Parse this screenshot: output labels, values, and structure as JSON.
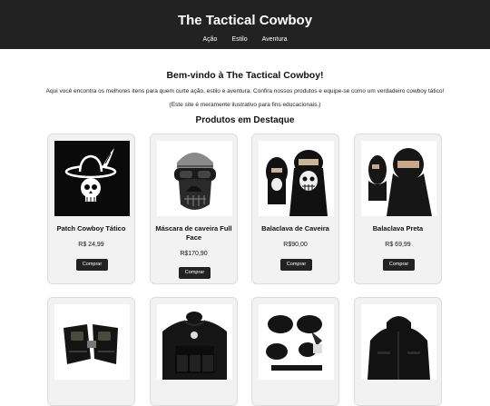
{
  "header": {
    "title": "The Tactical Cowboy",
    "nav": [
      "Ação",
      "Estilo",
      "Aventura"
    ]
  },
  "welcome": {
    "title": "Bem-vindo à The Tactical Cowboy!",
    "intro": "Aqui você encontra os melhores itens para quem curte ação, estilo e aventura. Confira nossos produtos e equipe-se como um verdadeiro cowboy tático!",
    "disclaimer": "(Este site é meramente ilustrativo para fins educacionais.)"
  },
  "section_title": "Produtos em Destaque",
  "products": [
    {
      "name": "Patch Cowboy Tático",
      "price": "R$ 24,99",
      "button": "Comprar",
      "icon": "cowboy-skull-patch-icon"
    },
    {
      "name": "Máscara de caveira Full Face",
      "price": "R$170,90",
      "button": "Comprar",
      "icon": "skull-mask-icon"
    },
    {
      "name": "Balaclava de Caveira",
      "price": "R$90,00",
      "button": "Comprar",
      "icon": "skull-balaclava-icon"
    },
    {
      "name": "Balaclava Preta",
      "price": "R$ 69,99",
      "button": "Comprar",
      "icon": "black-balaclava-icon"
    }
  ],
  "row2_products": [
    {
      "icon": "tactical-gloves-icon"
    },
    {
      "icon": "tactical-vest-icon"
    },
    {
      "icon": "knee-pads-icon"
    },
    {
      "icon": "tactical-jacket-icon"
    }
  ],
  "colors": {
    "header_bg": "#222222",
    "card_bg": "#f2f2f2",
    "button_bg": "#222222"
  }
}
